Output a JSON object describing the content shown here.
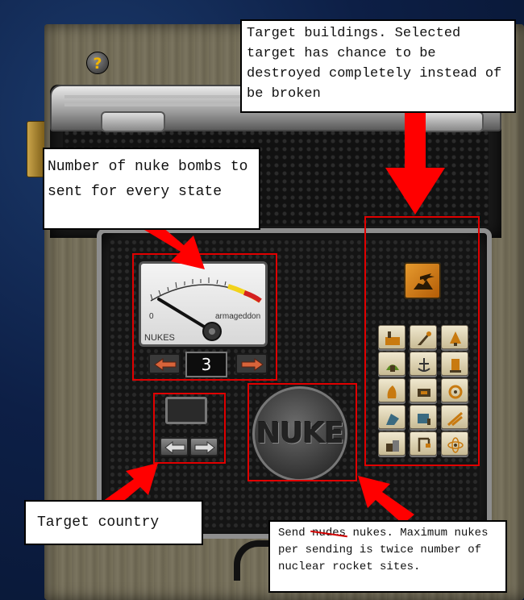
{
  "help_button": {
    "label": "?"
  },
  "gauge": {
    "scale_min_label": "0",
    "scale_max_label": "armageddon",
    "title": "NUKES"
  },
  "nuke_count": {
    "value": "3"
  },
  "nuke_button": {
    "label": "NUKE"
  },
  "annotations": {
    "target_buildings": "Target buildings. Selected target has chance to be destroyed completely instead of be broken",
    "nuke_bombs": "Number of nuke bombs to sent for every state",
    "target_country": "Target country",
    "send_prefix": "Send",
    "send_struck": "nudes",
    "send_rest": "nukes. Maximum nukes per sending is twice number of nuclear rocket sites."
  },
  "colors": {
    "annotation_red": "#e00000",
    "arrow_orange": "#d8643a",
    "selected_tile": "#e69a2e"
  },
  "building_icons": [
    "factory-icon",
    "rocket-icon",
    "bell-icon",
    "farm-icon",
    "anchor-icon",
    "silo-icon",
    "oil-icon",
    "mine-icon",
    "radar-icon",
    "barracks-icon",
    "refinery-icon",
    "launcher-icon",
    "housing-icon",
    "crane-icon",
    "atom-icon"
  ],
  "selected_building_icon": "airbase-icon"
}
